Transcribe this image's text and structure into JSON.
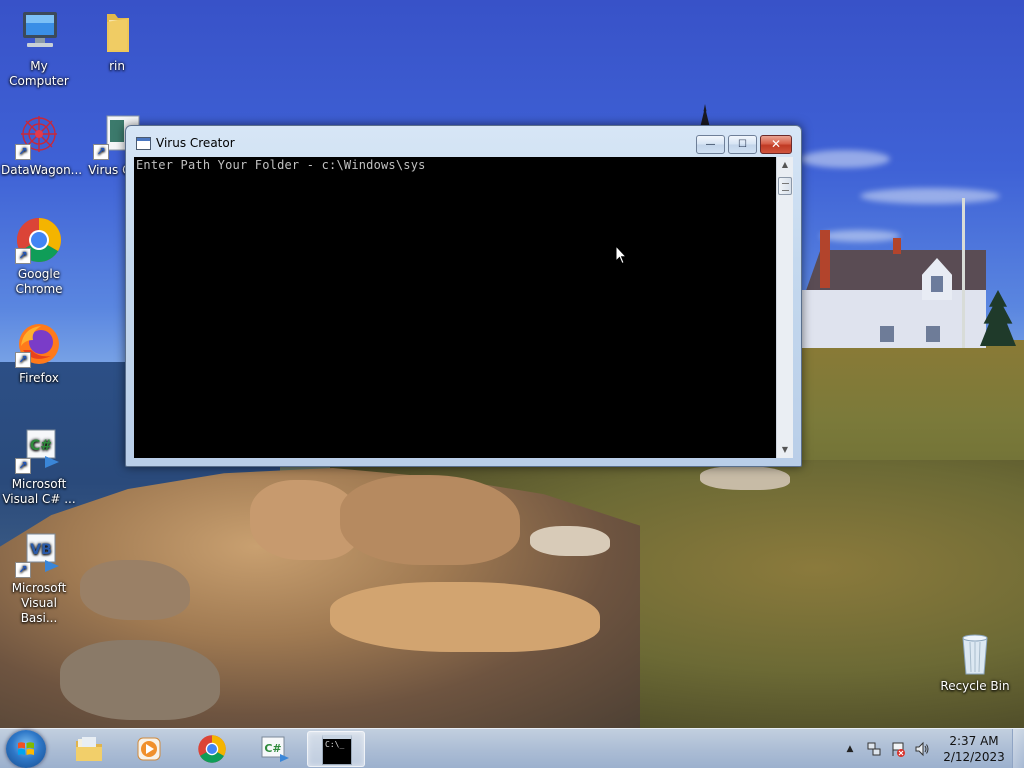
{
  "desktop": {
    "icons": [
      {
        "label": "My Computer"
      },
      {
        "label": "rin"
      },
      {
        "label": "DataWagon..."
      },
      {
        "label": "Virus Cr..."
      },
      {
        "label": "Google Chrome"
      },
      {
        "label": "Firefox"
      },
      {
        "label": "Microsoft Visual C# ..."
      },
      {
        "label": "Microsoft Visual Basi..."
      },
      {
        "label": "Recycle Bin"
      }
    ]
  },
  "window": {
    "title": "Virus Creator",
    "console_text": "Enter Path Your Folder - c:\\Windows\\sys",
    "buttons": {
      "minimize": "—",
      "maximize": "☐",
      "close": "✕"
    }
  },
  "taskbar": {
    "tasks": [
      {
        "name": "file-explorer-icon"
      },
      {
        "name": "media-player-icon"
      },
      {
        "name": "google-chrome-icon"
      },
      {
        "name": "visual-csharp-icon"
      },
      {
        "name": "command-prompt-icon",
        "label": "C:\\_"
      }
    ],
    "clock": {
      "time": "2:37 AM",
      "date": "2/12/2023"
    },
    "tray": {
      "show_hidden": "▲"
    }
  },
  "colors": {
    "console_bg": "#000000",
    "console_fg": "#c0c0c0",
    "taskbar": "#b2c4de"
  }
}
